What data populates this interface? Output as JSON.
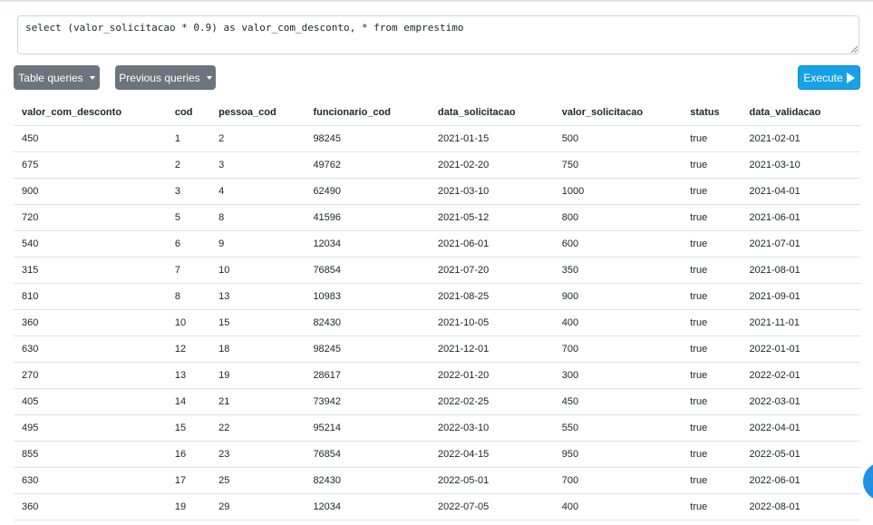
{
  "query": {
    "text": "select (valor_solicitacao * 0.9) as valor_com_desconto, * from emprestimo"
  },
  "toolbar": {
    "table_queries_label": "Table queries",
    "previous_queries_label": "Previous queries",
    "execute_label": "Execute"
  },
  "colors": {
    "execute": "#17a2e8",
    "secondary": "#6c757d"
  },
  "table": {
    "columns": [
      "valor_com_desconto",
      "cod",
      "pessoa_cod",
      "funcionario_cod",
      "data_solicitacao",
      "valor_solicitacao",
      "status",
      "data_validacao"
    ],
    "rows": [
      [
        "450",
        "1",
        "2",
        "98245",
        "2021-01-15",
        "500",
        "true",
        "2021-02-01"
      ],
      [
        "675",
        "2",
        "3",
        "49762",
        "2021-02-20",
        "750",
        "true",
        "2021-03-10"
      ],
      [
        "900",
        "3",
        "4",
        "62490",
        "2021-03-10",
        "1000",
        "true",
        "2021-04-01"
      ],
      [
        "720",
        "5",
        "8",
        "41596",
        "2021-05-12",
        "800",
        "true",
        "2021-06-01"
      ],
      [
        "540",
        "6",
        "9",
        "12034",
        "2021-06-01",
        "600",
        "true",
        "2021-07-01"
      ],
      [
        "315",
        "7",
        "10",
        "76854",
        "2021-07-20",
        "350",
        "true",
        "2021-08-01"
      ],
      [
        "810",
        "8",
        "13",
        "10983",
        "2021-08-25",
        "900",
        "true",
        "2021-09-01"
      ],
      [
        "360",
        "10",
        "15",
        "82430",
        "2021-10-05",
        "400",
        "true",
        "2021-11-01"
      ],
      [
        "630",
        "12",
        "18",
        "98245",
        "2021-12-01",
        "700",
        "true",
        "2022-01-01"
      ],
      [
        "270",
        "13",
        "19",
        "28617",
        "2022-01-20",
        "300",
        "true",
        "2022-02-01"
      ],
      [
        "405",
        "14",
        "21",
        "73942",
        "2022-02-25",
        "450",
        "true",
        "2022-03-01"
      ],
      [
        "495",
        "15",
        "22",
        "95214",
        "2022-03-10",
        "550",
        "true",
        "2022-04-01"
      ],
      [
        "855",
        "16",
        "23",
        "76854",
        "2022-04-15",
        "950",
        "true",
        "2022-05-01"
      ],
      [
        "630",
        "17",
        "25",
        "82430",
        "2022-05-01",
        "700",
        "true",
        "2022-06-01"
      ],
      [
        "360",
        "19",
        "29",
        "12034",
        "2022-07-05",
        "400",
        "true",
        "2022-08-01"
      ]
    ]
  }
}
